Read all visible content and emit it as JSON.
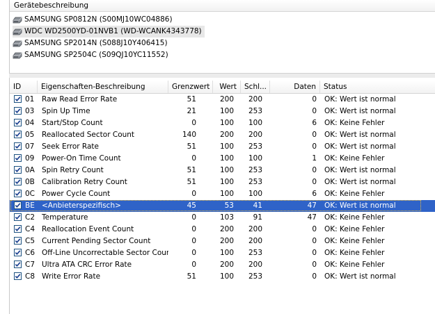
{
  "device_panel": {
    "header": "Gerätebeschreibung",
    "devices": [
      {
        "name": "SAMSUNG SP0812N (S00MJ10WC04886)",
        "selected": false
      },
      {
        "name": "WDC WD2500YD-01NVB1 (WD-WCANK4343778)",
        "selected": true
      },
      {
        "name": "SAMSUNG SP2014N (S088J10Y406415)",
        "selected": false
      },
      {
        "name": "SAMSUNG SP2504C (S09QJ10YC11552)",
        "selected": false
      }
    ]
  },
  "table": {
    "columns": {
      "id": "ID",
      "desc": "Eigenschaften-Beschreibung",
      "threshold": "Grenzwert",
      "value": "Wert",
      "worst": "Schl...",
      "data": "Daten",
      "status": "Status"
    },
    "rows": [
      {
        "id": "01",
        "desc": "Raw Read Error Rate",
        "threshold": "51",
        "value": "200",
        "worst": "200",
        "data": "0",
        "status": "OK: Wert ist normal"
      },
      {
        "id": "03",
        "desc": "Spin Up Time",
        "threshold": "21",
        "value": "100",
        "worst": "253",
        "data": "0",
        "status": "OK: Wert ist normal"
      },
      {
        "id": "04",
        "desc": "Start/Stop Count",
        "threshold": "0",
        "value": "100",
        "worst": "100",
        "data": "6",
        "status": "OK: Keine Fehler"
      },
      {
        "id": "05",
        "desc": "Reallocated Sector Count",
        "threshold": "140",
        "value": "200",
        "worst": "200",
        "data": "0",
        "status": "OK: Wert ist normal"
      },
      {
        "id": "07",
        "desc": "Seek Error Rate",
        "threshold": "51",
        "value": "100",
        "worst": "253",
        "data": "0",
        "status": "OK: Wert ist normal"
      },
      {
        "id": "09",
        "desc": "Power-On Time Count",
        "threshold": "0",
        "value": "100",
        "worst": "100",
        "data": "1",
        "status": "OK: Keine Fehler"
      },
      {
        "id": "0A",
        "desc": "Spin Retry Count",
        "threshold": "51",
        "value": "100",
        "worst": "253",
        "data": "0",
        "status": "OK: Wert ist normal"
      },
      {
        "id": "0B",
        "desc": "Calibration Retry Count",
        "threshold": "51",
        "value": "100",
        "worst": "253",
        "data": "0",
        "status": "OK: Wert ist normal"
      },
      {
        "id": "0C",
        "desc": "Power Cycle Count",
        "threshold": "0",
        "value": "100",
        "worst": "100",
        "data": "6",
        "status": "OK: Keine Fehler"
      },
      {
        "id": "BE",
        "desc": "<Anbieterspezifisch>",
        "threshold": "45",
        "value": "53",
        "worst": "41",
        "data": "47",
        "status": "OK: Wert ist normal",
        "selected": true
      },
      {
        "id": "C2",
        "desc": "Temperature",
        "threshold": "0",
        "value": "103",
        "worst": "91",
        "data": "47",
        "status": "OK: Keine Fehler"
      },
      {
        "id": "C4",
        "desc": "Reallocation Event Count",
        "threshold": "0",
        "value": "200",
        "worst": "200",
        "data": "0",
        "status": "OK: Keine Fehler"
      },
      {
        "id": "C5",
        "desc": "Current Pending Sector Count",
        "threshold": "0",
        "value": "200",
        "worst": "200",
        "data": "0",
        "status": "OK: Keine Fehler"
      },
      {
        "id": "C6",
        "desc": "Off-Line Uncorrectable Sector Count",
        "threshold": "0",
        "value": "100",
        "worst": "253",
        "data": "0",
        "status": "OK: Keine Fehler"
      },
      {
        "id": "C7",
        "desc": "Ultra ATA CRC Error Rate",
        "threshold": "0",
        "value": "200",
        "worst": "200",
        "data": "0",
        "status": "OK: Keine Fehler"
      },
      {
        "id": "C8",
        "desc": "Write Error Rate",
        "threshold": "51",
        "value": "100",
        "worst": "253",
        "data": "0",
        "status": "OK: Wert ist normal"
      }
    ]
  },
  "icons": {
    "device": "hard-disk-icon",
    "row_checkbox": "checkmark-icon"
  },
  "colors": {
    "selection": "#2f63c8",
    "checkbox_border": "#1c5180",
    "check": "#1a3f8f"
  }
}
